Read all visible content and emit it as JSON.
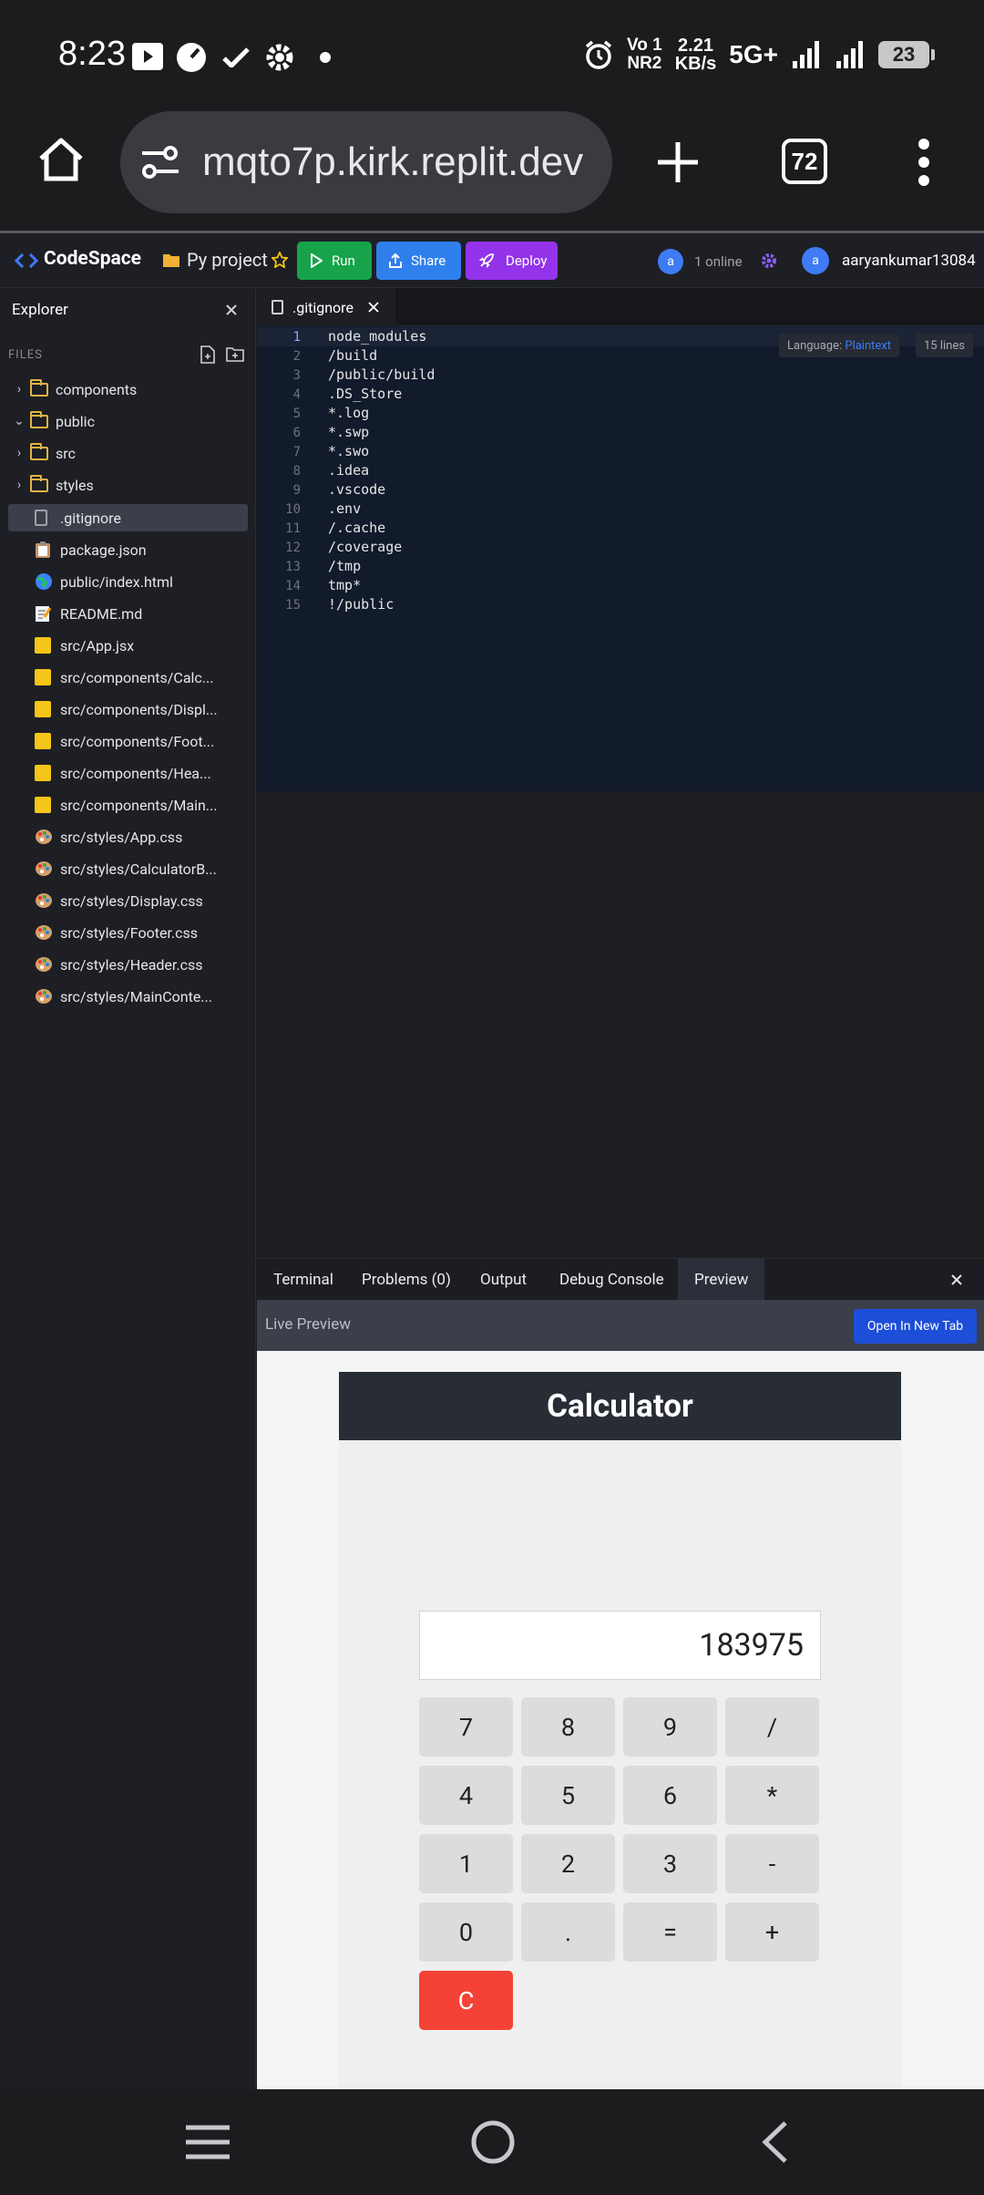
{
  "status_bar": {
    "time": "8:23",
    "carrier_top": "Vo 1",
    "carrier_bottom": "NR2",
    "speed_top": "2.21",
    "speed_bottom": "KB/s",
    "network": "5G+",
    "battery": "23"
  },
  "browser": {
    "url": "mqto7p.kirk.replit.dev",
    "tab_count": "72"
  },
  "app": {
    "name": "CodeSpace",
    "project": "Py project",
    "run_label": "Run",
    "share_label": "Share",
    "deploy_label": "Deploy",
    "online_avatar": "a",
    "online_label": "1 online",
    "user_avatar": "a",
    "username": "aaryankumar13084"
  },
  "sidebar": {
    "title": "Explorer",
    "files_label": "FILES",
    "folders": [
      {
        "name": "components"
      },
      {
        "name": "public"
      },
      {
        "name": "src"
      },
      {
        "name": "styles"
      }
    ],
    "files": [
      {
        "name": ".gitignore",
        "icon": "file-icon"
      },
      {
        "name": "package.json",
        "icon": "clipboard-icon"
      },
      {
        "name": "public/index.html",
        "icon": "globe-icon"
      },
      {
        "name": "README.md",
        "icon": "memo-icon"
      },
      {
        "name": "src/App.jsx",
        "icon": "js-icon"
      },
      {
        "name": "src/components/Calc...",
        "icon": "js-icon"
      },
      {
        "name": "src/components/Displ...",
        "icon": "js-icon"
      },
      {
        "name": "src/components/Foot...",
        "icon": "js-icon"
      },
      {
        "name": "src/components/Hea...",
        "icon": "js-icon"
      },
      {
        "name": "src/components/Main...",
        "icon": "js-icon"
      },
      {
        "name": "src/styles/App.css",
        "icon": "palette-icon"
      },
      {
        "name": "src/styles/CalculatorB...",
        "icon": "palette-icon"
      },
      {
        "name": "src/styles/Display.css",
        "icon": "palette-icon"
      },
      {
        "name": "src/styles/Footer.css",
        "icon": "palette-icon"
      },
      {
        "name": "src/styles/Header.css",
        "icon": "palette-icon"
      },
      {
        "name": "src/styles/MainConte...",
        "icon": "palette-icon"
      }
    ]
  },
  "editor": {
    "tab_name": ".gitignore",
    "language_label": "Language:",
    "language": "Plaintext",
    "line_count": "15 lines",
    "lines": [
      {
        "n": "1",
        "text": "node_modules"
      },
      {
        "n": "2",
        "text": "/build"
      },
      {
        "n": "3",
        "text": "/public/build"
      },
      {
        "n": "4",
        "text": ".DS_Store"
      },
      {
        "n": "5",
        "text": "*.log"
      },
      {
        "n": "6",
        "text": "*.swp"
      },
      {
        "n": "7",
        "text": "*.swo"
      },
      {
        "n": "8",
        "text": ".idea"
      },
      {
        "n": "9",
        "text": ".vscode"
      },
      {
        "n": "10",
        "text": ".env"
      },
      {
        "n": "11",
        "text": "/.cache"
      },
      {
        "n": "12",
        "text": "/coverage"
      },
      {
        "n": "13",
        "text": "/tmp"
      },
      {
        "n": "14",
        "text": "tmp*"
      },
      {
        "n": "15",
        "text": "!/public"
      }
    ]
  },
  "panel": {
    "tabs": [
      "Terminal",
      "Problems (0)",
      "Output",
      "Debug Console",
      "Preview"
    ],
    "active_tab": "Preview",
    "live_label": "Live Preview",
    "open_new_tab": "Open In New Tab"
  },
  "calculator": {
    "title": "Calculator",
    "display": "183975",
    "keys": [
      [
        "7",
        "8",
        "9",
        "/"
      ],
      [
        "4",
        "5",
        "6",
        "*"
      ],
      [
        "1",
        "2",
        "3",
        "-"
      ],
      [
        "0",
        ".",
        "=",
        "+"
      ]
    ],
    "clear": "C"
  },
  "colors": {
    "accent_blue": "#3e7bf5",
    "run_green": "#16a34a",
    "share_blue": "#2f80ed",
    "deploy_purple": "#9333ea",
    "folder_yellow": "#e3b341",
    "clear_red": "#f44336"
  }
}
